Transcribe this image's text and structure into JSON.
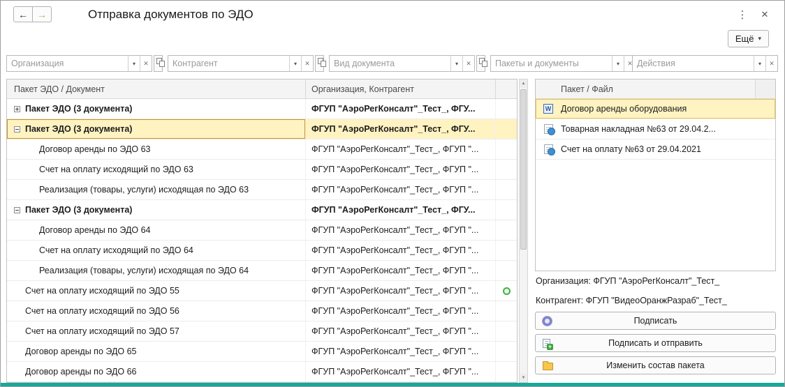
{
  "window": {
    "title": "Отправка документов по ЭДО",
    "more_button": "Ещё",
    "back_icon": "←",
    "forward_icon": "→",
    "menu_icon": "⋮",
    "close_icon": "✕",
    "caret_icon": "▾"
  },
  "filter_icons": {
    "dropdown": "▾",
    "clear": "✕"
  },
  "scrollbar": {
    "up": "▲",
    "down": "▼"
  },
  "filters": [
    {
      "placeholder": "Организация",
      "list_button": true
    },
    {
      "placeholder": "Контрагент",
      "list_button": true
    },
    {
      "placeholder": "Вид документа",
      "list_button": true
    },
    {
      "placeholder": "Пакеты и документы",
      "list_button": false
    },
    {
      "placeholder": "Действия",
      "list_button": false
    }
  ],
  "left_table": {
    "columns": [
      "Пакет ЭДО / Документ",
      "Организация, Контрагент"
    ],
    "rows": [
      {
        "text": "Пакет ЭДО (3 документа)",
        "org": "ФГУП \"АэроРегКонсалт\"_Тест_, ФГУ...",
        "bold": true,
        "expander": "plus",
        "indent": 0,
        "selected": false,
        "status": false
      },
      {
        "text": "Пакет ЭДО (3 документа)",
        "org": "ФГУП \"АэроРегКонсалт\"_Тест_, ФГУ...",
        "bold": true,
        "expander": "minus",
        "indent": 0,
        "selected": true,
        "status": false
      },
      {
        "text": "Договор аренды по ЭДО 63",
        "org": "ФГУП \"АэроРегКонсалт\"_Тест_, ФГУП \"...",
        "bold": false,
        "expander": null,
        "indent": 1,
        "selected": false,
        "status": false
      },
      {
        "text": "Счет на оплату исходящий по ЭДО 63",
        "org": "ФГУП \"АэроРегКонсалт\"_Тест_, ФГУП \"...",
        "bold": false,
        "expander": null,
        "indent": 1,
        "selected": false,
        "status": false
      },
      {
        "text": "Реализация (товары, услуги) исходящая по ЭДО 63",
        "org": "ФГУП \"АэроРегКонсалт\"_Тест_, ФГУП \"...",
        "bold": false,
        "expander": null,
        "indent": 1,
        "selected": false,
        "status": false
      },
      {
        "text": "Пакет ЭДО (3 документа)",
        "org": "ФГУП \"АэроРегКонсалт\"_Тест_, ФГУ...",
        "bold": true,
        "expander": "minus",
        "indent": 0,
        "selected": false,
        "status": false
      },
      {
        "text": "Договор аренды по ЭДО 64",
        "org": "ФГУП \"АэроРегКонсалт\"_Тест_, ФГУП \"...",
        "bold": false,
        "expander": null,
        "indent": 1,
        "selected": false,
        "status": false
      },
      {
        "text": "Счет на оплату исходящий по ЭДО 64",
        "org": "ФГУП \"АэроРегКонсалт\"_Тест_, ФГУП \"...",
        "bold": false,
        "expander": null,
        "indent": 1,
        "selected": false,
        "status": false
      },
      {
        "text": "Реализация (товары, услуги) исходящая по ЭДО 64",
        "org": "ФГУП \"АэроРегКонсалт\"_Тест_, ФГУП \"...",
        "bold": false,
        "expander": null,
        "indent": 1,
        "selected": false,
        "status": false
      },
      {
        "text": "Счет на оплату исходящий по ЭДО 55",
        "org": "ФГУП \"АэроРегКонсалт\"_Тест_, ФГУП \"...",
        "bold": false,
        "expander": null,
        "indent": 0,
        "selected": false,
        "status": true
      },
      {
        "text": "Счет на оплату исходящий по ЭДО 56",
        "org": "ФГУП \"АэроРегКонсалт\"_Тест_, ФГУП \"...",
        "bold": false,
        "expander": null,
        "indent": 0,
        "selected": false,
        "status": false
      },
      {
        "text": "Счет на оплату исходящий по ЭДО 57",
        "org": "ФГУП \"АэроРегКонсалт\"_Тест_, ФГУП \"...",
        "bold": false,
        "expander": null,
        "indent": 0,
        "selected": false,
        "status": false
      },
      {
        "text": "Договор аренды по ЭДО 65",
        "org": "ФГУП \"АэроРегКонсалт\"_Тест_, ФГУП \"...",
        "bold": false,
        "expander": null,
        "indent": 0,
        "selected": false,
        "status": false
      },
      {
        "text": "Договор аренды по ЭДО 66",
        "org": "ФГУП \"АэроРегКонсалт\"_Тест_, ФГУП \"...",
        "bold": false,
        "expander": null,
        "indent": 0,
        "selected": false,
        "status": false
      }
    ]
  },
  "right_table": {
    "columns": [
      "Пакет / Файл"
    ],
    "rows": [
      {
        "text": "Договор аренды оборудования",
        "icon": "word-file-icon",
        "icon_text": "W",
        "selected": true
      },
      {
        "text": "Товарная накладная №63 от 29.04.2...",
        "icon": "edo-document-icon",
        "icon_text": "",
        "selected": false
      },
      {
        "text": "Счет на оплату №63 от 29.04.2021",
        "icon": "edo-document-icon",
        "icon_text": "",
        "selected": false
      }
    ]
  },
  "details": {
    "organization": "Организация: ФГУП \"АэроРегКонсалт\"_Тест_",
    "counterparty": "Контрагент: ФГУП \"ВидеоОранжРазраб\"_Тест_"
  },
  "actions": [
    {
      "label": "Подписать",
      "name": "sign-button",
      "icon": "signature-icon"
    },
    {
      "label": "Подписать и отправить",
      "name": "sign-and-send-button",
      "icon": "sign-send-icon"
    },
    {
      "label": "Изменить состав пакета",
      "name": "edit-package-button",
      "icon": "folder-icon"
    }
  ],
  "colors": {
    "selection": "#fff3c2",
    "selection_border": "#c9921c",
    "status_green": "#44b049",
    "bottom_strip": "#19a79c"
  }
}
